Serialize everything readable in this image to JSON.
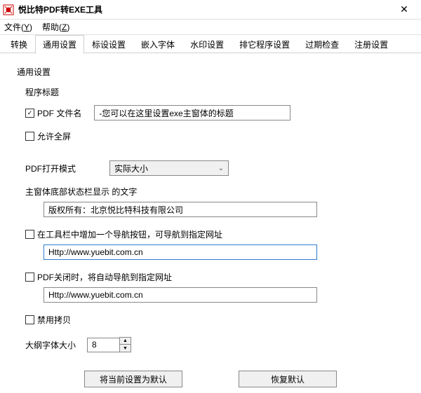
{
  "window": {
    "title": "悦比特PDF转EXE工具"
  },
  "menubar": {
    "file": "文件",
    "file_accel": "Y",
    "help": "帮助",
    "help_accel": "Z"
  },
  "tabs": {
    "items": [
      {
        "label": "转换"
      },
      {
        "label": "通用设置"
      },
      {
        "label": "标设设置"
      },
      {
        "label": "嵌入字体"
      },
      {
        "label": "水印设置"
      },
      {
        "label": "排它程序设置"
      },
      {
        "label": "过期检查"
      },
      {
        "label": "注册设置"
      }
    ],
    "activeIndex": 1
  },
  "form": {
    "group_label": "通用设置",
    "program_title_label": "程序标题",
    "pdf_filename_checkbox_label": "PDF 文件名",
    "pdf_filename_checked": true,
    "title_input_value": "-您可以在这里设置exe主窗体的标题",
    "allow_fullscreen_label": "允许全屏",
    "allow_fullscreen_checked": false,
    "open_mode_label": "PDF打开模式",
    "open_mode_value": "实际大小",
    "statusbar_label": "主窗体底部状态栏显示 的文字",
    "statusbar_value": "版权所有：北京悦比特科技有限公司",
    "toolbar_nav_label": "在工具栏中增加一个导航按钮，可导航到指定网址",
    "toolbar_nav_checked": false,
    "toolbar_nav_url": "Http://www.yuebit.com.cn",
    "close_nav_label": "PDF关闭时，将自动导航到指定网址",
    "close_nav_checked": false,
    "close_nav_url": "Http://www.yuebit.com.cn",
    "disable_copy_label": "禁用拷贝",
    "disable_copy_checked": false,
    "outline_fontsize_label": "大纲字体大小",
    "outline_fontsize_value": "8",
    "btn_set_default": "将当前设置为默认",
    "btn_restore_default": "恢复默认"
  }
}
